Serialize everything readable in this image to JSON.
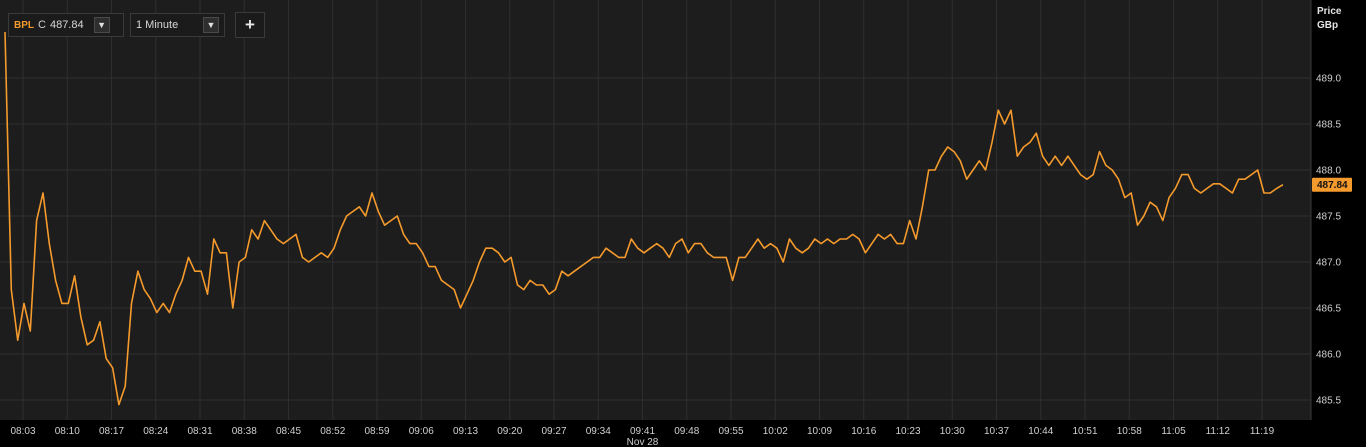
{
  "toolbar": {
    "symbol": "BPL",
    "close_prefix": "C",
    "close_value": "487.84",
    "interval": "1 Minute",
    "dropdown_arrow": "▼",
    "add_label": "+"
  },
  "axis": {
    "title_line1": "Price",
    "title_line2": "GBp",
    "current_tag": "487.84"
  },
  "colors": {
    "line": "#f59a2c",
    "tag_bg": "#f59a2c",
    "grid": "#2e2e2e",
    "plot_bg": "#1d1d1d"
  },
  "chart_data": {
    "type": "line",
    "ylim": [
      485.3,
      489.6
    ],
    "y_ticks": [
      "489.0",
      "488.5",
      "488.0",
      "487.5",
      "487.0",
      "486.5",
      "486.0",
      "485.5"
    ],
    "y_tick_values": [
      489.0,
      488.5,
      488.0,
      487.5,
      487.0,
      486.5,
      486.0,
      485.5
    ],
    "x_ticks": [
      "08:03",
      "08:10",
      "08:17",
      "08:24",
      "08:31",
      "08:38",
      "08:45",
      "08:52",
      "08:59",
      "09:06",
      "09:13",
      "09:20",
      "09:27",
      "09:34",
      "09:41",
      "09:48",
      "09:55",
      "10:02",
      "10:09",
      "10:16",
      "10:23",
      "10:30",
      "10:37",
      "10:44",
      "10:51",
      "10:58",
      "11:05",
      "11:12",
      "11:19"
    ],
    "date_label": "Nov 28",
    "date_under_tick": "09:41",
    "series": [
      {
        "values": [
          489.5,
          486.7,
          486.15,
          486.55,
          486.25,
          487.45,
          487.75,
          487.2,
          486.8,
          486.55,
          486.55,
          486.85,
          486.4,
          486.1,
          486.15,
          486.35,
          485.95,
          485.85,
          485.45,
          485.65,
          486.55,
          486.9,
          486.7,
          486.6,
          486.45,
          486.55,
          486.45,
          486.65,
          486.8,
          487.05,
          486.9,
          486.9,
          486.65,
          487.25,
          487.1,
          487.1,
          486.5,
          487.0,
          487.05,
          487.35,
          487.25,
          487.45,
          487.35,
          487.25,
          487.2,
          487.25,
          487.3,
          487.05,
          487.0,
          487.05,
          487.1,
          487.05,
          487.15,
          487.35,
          487.5,
          487.55,
          487.6,
          487.5,
          487.75,
          487.55,
          487.4,
          487.45,
          487.5,
          487.3,
          487.2,
          487.2,
          487.1,
          486.95,
          486.95,
          486.8,
          486.75,
          486.7,
          486.5,
          486.65,
          486.8,
          487.0,
          487.15,
          487.15,
          487.1,
          487.0,
          487.05,
          486.75,
          486.7,
          486.8,
          486.75,
          486.75,
          486.65,
          486.7,
          486.9,
          486.85,
          486.9,
          486.95,
          487.0,
          487.05,
          487.05,
          487.15,
          487.1,
          487.05,
          487.05,
          487.25,
          487.15,
          487.1,
          487.15,
          487.2,
          487.15,
          487.05,
          487.2,
          487.25,
          487.1,
          487.2,
          487.2,
          487.1,
          487.05,
          487.05,
          487.05,
          486.8,
          487.05,
          487.05,
          487.15,
          487.25,
          487.15,
          487.2,
          487.15,
          487.0,
          487.25,
          487.15,
          487.1,
          487.15,
          487.25,
          487.2,
          487.25,
          487.2,
          487.25,
          487.25,
          487.3,
          487.25,
          487.1,
          487.2,
          487.3,
          487.25,
          487.3,
          487.2,
          487.2,
          487.45,
          487.25,
          487.6,
          488.0,
          488.0,
          488.15,
          488.25,
          488.2,
          488.1,
          487.9,
          488.0,
          488.1,
          488.0,
          488.3,
          488.65,
          488.5,
          488.65,
          488.15,
          488.25,
          488.3,
          488.4,
          488.15,
          488.05,
          488.15,
          488.05,
          488.15,
          488.05,
          487.95,
          487.9,
          487.95,
          488.2,
          488.05,
          488.0,
          487.9,
          487.7,
          487.75,
          487.4,
          487.5,
          487.65,
          487.6,
          487.45,
          487.7,
          487.8,
          487.95,
          487.95,
          487.8,
          487.75,
          487.8,
          487.85,
          487.85,
          487.8,
          487.75,
          487.9,
          487.9,
          487.95,
          488.0,
          487.75,
          487.75,
          487.8,
          487.84
        ]
      }
    ]
  }
}
